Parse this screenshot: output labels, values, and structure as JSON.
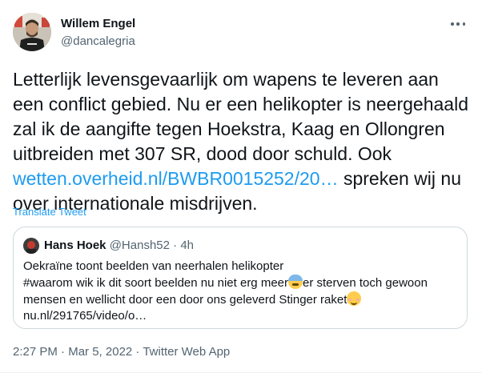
{
  "author": {
    "name": "Willem Engel",
    "handle": "@dancalegria"
  },
  "tweet": {
    "text_before_link": "Letterlijk levensgevaarlijk om wapens te leveren aan een conflict gebied. Nu er een helikopter is neergehaald zal ik de aangifte tegen Hoekstra, Kaag en Ollongren uitbreiden met 307 SR, dood door schuld. Ook ",
    "link": "wetten.overheid.nl/BWBR0015252/20…",
    "text_after_link": " spreken wij nu over internationale misdrijven.",
    "translate_label": "Translate Tweet"
  },
  "quote": {
    "name": "Hans Hoek",
    "handle": "@Hansh52",
    "time": "· 4h",
    "line1": "Oekraïne toont beelden van neerhalen helikopter",
    "line2_a": "#waarom wik ik dit soort beelden  nu niet erg meer",
    "line2_b": "er sterven toch gewoon",
    "line3": "mensen en wellicht door een door ons geleverd Stinger raket",
    "link": "nu.nl/291765/video/o…",
    "emoji_1": "anxious-face-with-sweat",
    "emoji_2": "smiling-face-with-smiling-eyes"
  },
  "meta": {
    "time": "2:27 PM",
    "sep1": " · ",
    "date": "Mar 5, 2022",
    "sep2": " · ",
    "source": "Twitter Web App"
  },
  "colors": {
    "link": "#1d9bf0",
    "secondary_text": "#536471",
    "border": "#cfd9de"
  }
}
